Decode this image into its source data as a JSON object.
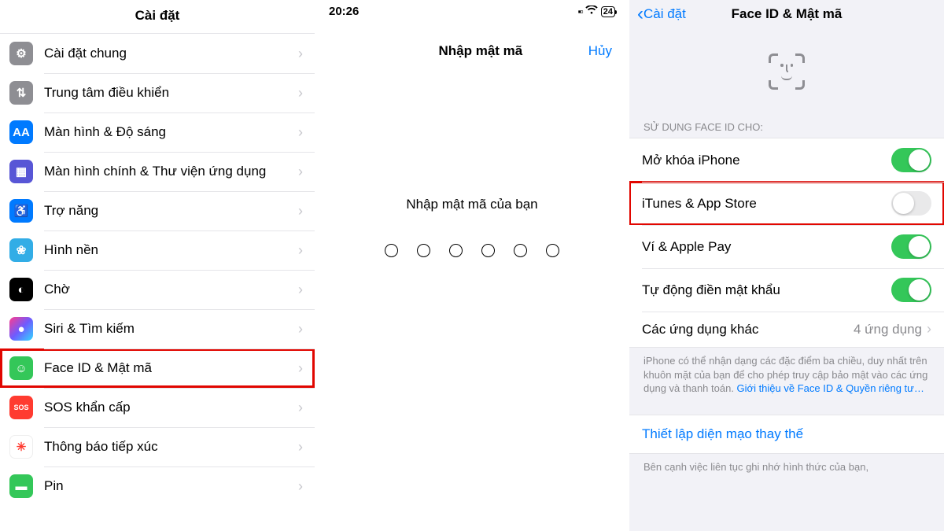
{
  "panel1": {
    "title": "Cài đặt",
    "items": [
      {
        "label": "Cài đặt chung",
        "icon": "gear-icon",
        "bg": "bg-gray",
        "glyph": "⚙"
      },
      {
        "label": "Trung tâm điều khiển",
        "icon": "toggles-icon",
        "bg": "bg-gray2",
        "glyph": "⇅"
      },
      {
        "label": "Màn hình & Độ sáng",
        "icon": "brightness-icon",
        "bg": "bg-blue",
        "glyph": "AA"
      },
      {
        "label": "Màn hình chính & Thư viện ứng dụng",
        "icon": "home-grid-icon",
        "bg": "bg-indigo",
        "glyph": "▦"
      },
      {
        "label": "Trợ năng",
        "icon": "accessibility-icon",
        "bg": "bg-blue",
        "glyph": "♿"
      },
      {
        "label": "Hình nền",
        "icon": "wallpaper-icon",
        "bg": "bg-cyan",
        "glyph": "❀"
      },
      {
        "label": "Chờ",
        "icon": "standby-icon",
        "bg": "bg-black",
        "glyph": "◐"
      },
      {
        "label": "Siri & Tìm kiếm",
        "icon": "siri-icon",
        "bg": "bg-siri",
        "glyph": "●"
      },
      {
        "label": "Face ID & Mật mã",
        "icon": "faceid-icon",
        "bg": "bg-green",
        "glyph": "☺",
        "highlight": true
      },
      {
        "label": "SOS khẩn cấp",
        "icon": "sos-icon",
        "bg": "bg-red",
        "glyph": "SOS"
      },
      {
        "label": "Thông báo tiếp xúc",
        "icon": "exposure-icon",
        "bg": "bg-white",
        "glyph": "✳"
      },
      {
        "label": "Pin",
        "icon": "battery-icon",
        "bg": "bg-batt",
        "glyph": "▬"
      }
    ]
  },
  "panel2": {
    "status_time": "20:26",
    "status_battery": "24",
    "nav_title": "Nhập mật mã",
    "cancel": "Hủy",
    "prompt": "Nhập mật mã của bạn",
    "dot_count": 6
  },
  "panel3": {
    "back": "Cài đặt",
    "title": "Face ID & Mật mã",
    "section_header": "SỬ DỤNG FACE ID CHO:",
    "rows": [
      {
        "label": "Mở khóa iPhone",
        "on": true
      },
      {
        "label": "iTunes & App Store",
        "on": false,
        "highlight": true
      },
      {
        "label": "Ví & Apple Pay",
        "on": true
      },
      {
        "label": "Tự động điền mật khẩu",
        "on": true
      }
    ],
    "other_apps": {
      "label": "Các ứng dụng khác",
      "detail": "4 ứng dụng"
    },
    "footer_text": "iPhone có thể nhận dạng các đặc điểm ba chiều, duy nhất trên khuôn mặt của bạn để cho phép truy cập bảo mật vào các ứng dụng và thanh toán. ",
    "footer_link": "Giới thiệu về Face ID & Quyền riêng tư…",
    "alt_appearance": "Thiết lập diện mạo thay thế",
    "footer2": "Bên cạnh việc liên tục ghi nhớ hình thức của bạn,"
  }
}
